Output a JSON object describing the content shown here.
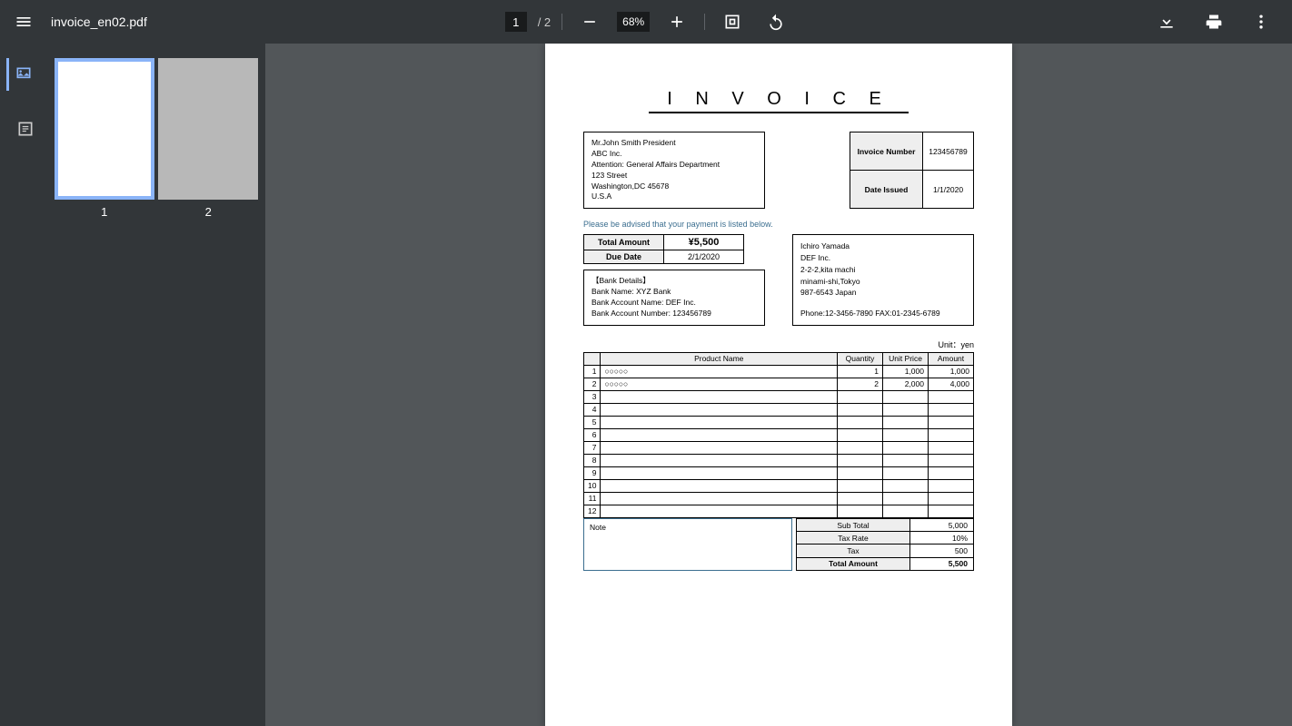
{
  "toolbar": {
    "filename": "invoice_en02.pdf",
    "current_page": "1",
    "total_pages": "2",
    "zoom": "68%"
  },
  "thumbs": [
    {
      "label": "1"
    },
    {
      "label": "2"
    }
  ],
  "invoice": {
    "title": "I N V O I C E",
    "meta": {
      "inv_num_label": "Invoice Number",
      "inv_num": "123456789",
      "date_label": "Date Issued",
      "date": "1/1/2020"
    },
    "billto": {
      "l1": "Mr.John Smith President",
      "l2": "ABC Inc.",
      "l3": "Attention: General Affairs Department",
      "l4": "123 Street",
      "l5": "Washington,DC 45678",
      "l6": "U.S.A"
    },
    "notice": "Please be advised that your payment is listed below.",
    "summary": {
      "total_label": "Total Amount",
      "total": "¥5,500",
      "due_label": "Due Date",
      "due": "2/1/2020"
    },
    "bank": {
      "title": "【Bank Details】",
      "l1": "Bank Name: XYZ Bank",
      "l2": "Bank Account Name: DEF Inc.",
      "l3": "Bank Account Number: 123456789"
    },
    "vendor": {
      "l1": "Ichiro Yamada",
      "l2": "DEF Inc.",
      "l3": "2-2-2,kita machi",
      "l4": "minami-shi,Tokyo",
      "l5": "987-6543 Japan",
      "l6": "Phone:12-3456-7890    FAX:01-2345-6789"
    },
    "unit": "Unit：yen",
    "headers": {
      "product": "Product Name",
      "qty": "Quantity",
      "price": "Unit Price",
      "amount": "Amount"
    },
    "items": [
      {
        "n": "1",
        "name": "○○○○○",
        "qty": "1",
        "price": "1,000",
        "amount": "1,000"
      },
      {
        "n": "2",
        "name": "○○○○○",
        "qty": "2",
        "price": "2,000",
        "amount": "4,000"
      },
      {
        "n": "3",
        "name": "",
        "qty": "",
        "price": "",
        "amount": ""
      },
      {
        "n": "4",
        "name": "",
        "qty": "",
        "price": "",
        "amount": ""
      },
      {
        "n": "5",
        "name": "",
        "qty": "",
        "price": "",
        "amount": ""
      },
      {
        "n": "6",
        "name": "",
        "qty": "",
        "price": "",
        "amount": ""
      },
      {
        "n": "7",
        "name": "",
        "qty": "",
        "price": "",
        "amount": ""
      },
      {
        "n": "8",
        "name": "",
        "qty": "",
        "price": "",
        "amount": ""
      },
      {
        "n": "9",
        "name": "",
        "qty": "",
        "price": "",
        "amount": ""
      },
      {
        "n": "10",
        "name": "",
        "qty": "",
        "price": "",
        "amount": ""
      },
      {
        "n": "11",
        "name": "",
        "qty": "",
        "price": "",
        "amount": ""
      },
      {
        "n": "12",
        "name": "",
        "qty": "",
        "price": "",
        "amount": ""
      }
    ],
    "note_label": "Note",
    "totals": {
      "subtotal_label": "Sub Total",
      "subtotal": "5,000",
      "taxrate_label": "Tax Rate",
      "taxrate": "10%",
      "tax_label": "Tax",
      "tax": "500",
      "total_label": "Total Amount",
      "total": "5,500"
    }
  }
}
